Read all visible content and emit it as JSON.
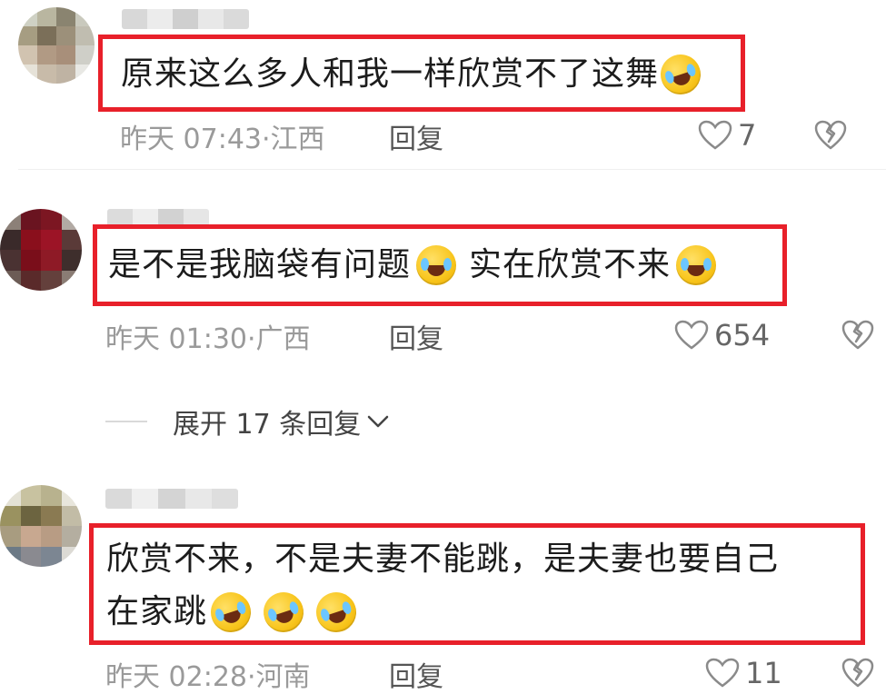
{
  "colors": {
    "highlight_border": "#e8202a",
    "meta_text": "#9a9a9a",
    "body_text": "#1c1c1c"
  },
  "comments": [
    {
      "lines": [
        "原来这么多人和我一样欣赏不了这舞"
      ],
      "emoji_after": "laughing-tears-emoji",
      "time": "昨天 07:43",
      "location": "江西",
      "reply_label": "回复",
      "likes": "7"
    },
    {
      "lines": [
        "是不是我脑袋有问题",
        "实在欣赏不来"
      ],
      "emoji_after": "laughing-tears-emoji",
      "time": "昨天 01:30",
      "location": "广西",
      "reply_label": "回复",
      "likes": "654"
    },
    {
      "lines": [
        "欣赏不来，不是夫妻不能跳，是夫妻也要自己",
        "在家跳"
      ],
      "emoji_after": "laughing-tears-emoji",
      "time": "昨天 02:28",
      "location": "河南",
      "reply_label": "回复",
      "likes": "11"
    }
  ],
  "expand_replies": {
    "label": "展开 17 条回复"
  }
}
